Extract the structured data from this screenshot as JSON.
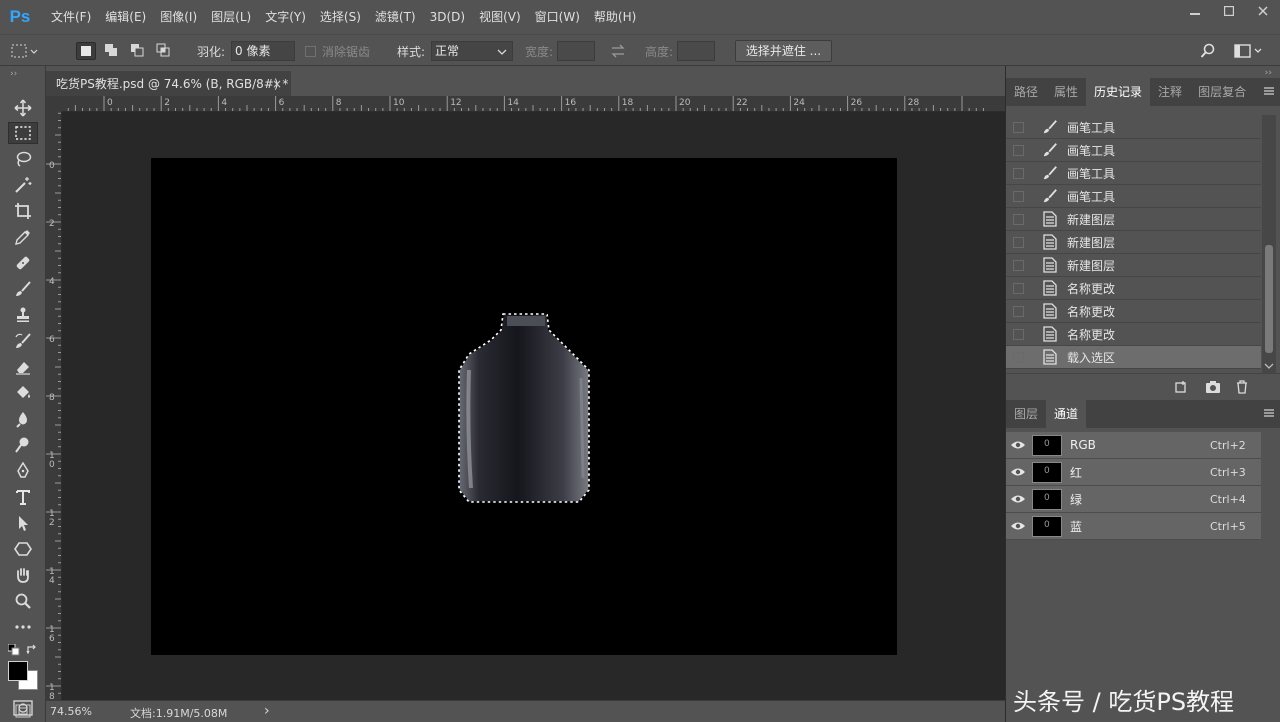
{
  "app": {
    "logo": "Ps"
  },
  "menu": [
    "文件(F)",
    "编辑(E)",
    "图像(I)",
    "图层(L)",
    "文字(Y)",
    "选择(S)",
    "滤镜(T)",
    "3D(D)",
    "视图(V)",
    "窗口(W)",
    "帮助(H)"
  ],
  "options": {
    "feather_label": "羽化:",
    "feather_value": "0 像素",
    "antialias_label": "消除锯齿",
    "style_label": "样式:",
    "style_value": "正常",
    "width_label": "宽度:",
    "height_label": "高度:",
    "select_mask_button": "选择并遮住 ..."
  },
  "document": {
    "tab_title": "吃货PS教程.psd @ 74.6% (B, RGB/8#) *",
    "close_glyph": "×",
    "ruler_h": [
      "2",
      "0",
      "2",
      "4",
      "6",
      "8",
      "10",
      "12",
      "14",
      "16",
      "18",
      "20",
      "22",
      "24",
      "26",
      "28"
    ],
    "ruler_v": [
      "0",
      "2",
      "4",
      "6",
      "8",
      "1\n0",
      "1\n2",
      "1\n4",
      "1\n6",
      "1\n8"
    ]
  },
  "status": {
    "zoom": "74.56%",
    "doc_info": "文档:1.91M/5.08M",
    "arrow": "›"
  },
  "history_panel": {
    "tabs": [
      "路径",
      "属性",
      "历史记录",
      "注释",
      "图层复合"
    ],
    "active_tab": "历史记录",
    "items": [
      {
        "label": "画笔工具",
        "icon": "brush-icon"
      },
      {
        "label": "画笔工具",
        "icon": "brush-icon"
      },
      {
        "label": "画笔工具",
        "icon": "brush-icon"
      },
      {
        "label": "画笔工具",
        "icon": "brush-icon"
      },
      {
        "label": "新建图层",
        "icon": "document-icon"
      },
      {
        "label": "新建图层",
        "icon": "document-icon"
      },
      {
        "label": "新建图层",
        "icon": "document-icon"
      },
      {
        "label": "名称更改",
        "icon": "document-icon"
      },
      {
        "label": "名称更改",
        "icon": "document-icon"
      },
      {
        "label": "名称更改",
        "icon": "document-icon"
      },
      {
        "label": "载入选区",
        "icon": "document-icon",
        "selected": true
      }
    ]
  },
  "channels_panel": {
    "tabs": [
      "图层",
      "通道"
    ],
    "active_tab": "通道",
    "thumb_glyph": "0",
    "channels": [
      {
        "name": "RGB",
        "shortcut": "Ctrl+2"
      },
      {
        "name": "红",
        "shortcut": "Ctrl+3"
      },
      {
        "name": "绿",
        "shortcut": "Ctrl+4"
      },
      {
        "name": "蓝",
        "shortcut": "Ctrl+5"
      }
    ]
  },
  "watermark": "头条号 / 吃货PS教程",
  "colors": {
    "accent": "#31a8ff",
    "background": "#535353",
    "canvas": "#000000"
  }
}
